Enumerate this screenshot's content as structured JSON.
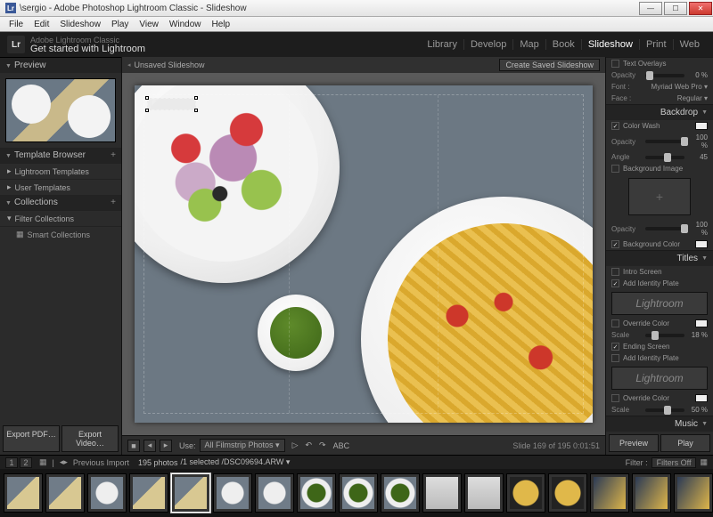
{
  "window": {
    "title": "\\sergio - Adobe Photoshop Lightroom Classic - Slideshow"
  },
  "osmenu": [
    "File",
    "Edit",
    "Slideshow",
    "Play",
    "View",
    "Window",
    "Help"
  ],
  "brand": {
    "line1": "Adobe Lightroom Classic",
    "line2": "Get started with Lightroom"
  },
  "logo": "Lr",
  "modules": [
    {
      "label": "Library",
      "active": false
    },
    {
      "label": "Develop",
      "active": false
    },
    {
      "label": "Map",
      "active": false
    },
    {
      "label": "Book",
      "active": false
    },
    {
      "label": "Slideshow",
      "active": true
    },
    {
      "label": "Print",
      "active": false
    },
    {
      "label": "Web",
      "active": false
    }
  ],
  "left": {
    "preview_title": "Preview",
    "template_title": "Template Browser",
    "templates": [
      "Lightroom Templates",
      "User Templates"
    ],
    "collections_title": "Collections",
    "collections": [
      {
        "label": "Filter Collections",
        "sub": false
      },
      {
        "label": "Smart Collections",
        "sub": true
      }
    ],
    "export_pdf": "Export PDF…",
    "export_video": "Export Video…"
  },
  "center": {
    "doc_title": "Unsaved Slideshow",
    "save_btn": "Create Saved Slideshow",
    "watermark": "Lightroom",
    "toolbar": {
      "use_label": "Use:",
      "use_value": "All Filmstrip Photos",
      "abc": "ABC",
      "status": "Slide 169 of 195   0:01:51"
    }
  },
  "right": {
    "text_overlay": {
      "title": "Text Overlays",
      "opacity_lbl": "Opacity",
      "opacity_val": "0 %",
      "font_lbl": "Font :",
      "font_val": "Myriad Web Pro ▾",
      "face_lbl": "Face :",
      "face_val": "Regular ▾"
    },
    "backdrop": {
      "title": "Backdrop",
      "colorwash": "Color Wash",
      "opacity_lbl": "Opacity",
      "opacity_val": "100 %",
      "angle_lbl": "Angle",
      "angle_val": "45",
      "bgimage": "Background Image",
      "bgimage_op_lbl": "Opacity",
      "bgimage_op_val": "100 %",
      "bgcolor": "Background Color"
    },
    "titles": {
      "title": "Titles",
      "intro": "Intro Screen",
      "add_identity": "Add Identity Plate",
      "plate": "Lightroom",
      "override": "Override Color",
      "scale_lbl": "Scale",
      "scale_val": "18 %",
      "ending": "Ending Screen",
      "add_identity2": "Add Identity Plate",
      "plate2": "Lightroom",
      "override2": "Override Color",
      "scale2_val": "50 %"
    },
    "music": {
      "title": "Music"
    },
    "preview_btn": "Preview",
    "play_btn": "Play"
  },
  "secondary": {
    "previous_import": "Previous Import",
    "count": "195 photos",
    "selected": "/1 selected /DSC09694.ARW ▾",
    "filter_lbl": "Filter :",
    "filter_val": "Filters Off"
  },
  "filmstrip_count": 17,
  "filmstrip_selected": 4
}
